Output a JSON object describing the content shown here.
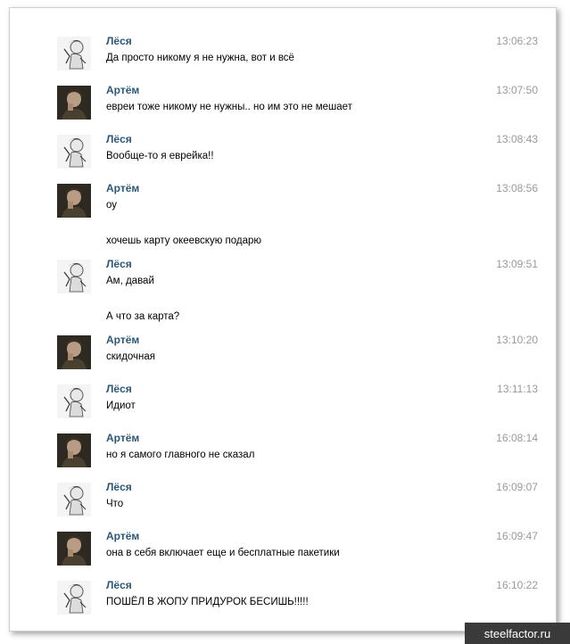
{
  "users": {
    "lesya": "Лёся",
    "artem": "Артём"
  },
  "messages": [
    {
      "author": "Лёся",
      "avatar": "lesya-avatar",
      "time": "13:06:23",
      "lines": [
        "Да просто никому я не нужна, вот и всё"
      ]
    },
    {
      "author": "Артём",
      "avatar": "artem-avatar",
      "time": "13:07:50",
      "lines": [
        "евреи тоже никому не нужны.. но им это не мешает"
      ]
    },
    {
      "author": "Лёся",
      "avatar": "lesya-avatar",
      "time": "13:08:43",
      "lines": [
        "Вообще-то я еврейка!!"
      ]
    },
    {
      "author": "Артём",
      "avatar": "artem-avatar",
      "time": "13:08:56",
      "lines": [
        "оу",
        "хочешь карту океевскую подарю"
      ]
    },
    {
      "author": "Лёся",
      "avatar": "lesya-avatar",
      "time": "13:09:51",
      "lines": [
        "Ам, давай",
        "А что за карта?"
      ]
    },
    {
      "author": "Артём",
      "avatar": "artem-avatar",
      "time": "13:10:20",
      "lines": [
        "скидочная"
      ]
    },
    {
      "author": "Лёся",
      "avatar": "lesya-avatar",
      "time": "13:11:13",
      "lines": [
        "Идиот"
      ]
    },
    {
      "author": "Артём",
      "avatar": "artem-avatar",
      "time": "16:08:14",
      "lines": [
        "но я самого главного не сказал"
      ]
    },
    {
      "author": "Лёся",
      "avatar": "lesya-avatar",
      "time": "16:09:07",
      "lines": [
        "Что"
      ]
    },
    {
      "author": "Артём",
      "avatar": "artem-avatar",
      "time": "16:09:47",
      "lines": [
        "она в себя включает еще и бесплатные пакетики"
      ]
    },
    {
      "author": "Лёся",
      "avatar": "lesya-avatar",
      "time": "16:10:22",
      "lines": [
        "ПОШЁЛ В ЖОПУ ПРИДУРОК БЕСИШЬ!!!!!"
      ]
    }
  ],
  "watermark": "steelfactor.ru",
  "colors": {
    "author": "#2b587a",
    "time": "#9a9a9a",
    "border": "#c9cfd6"
  }
}
